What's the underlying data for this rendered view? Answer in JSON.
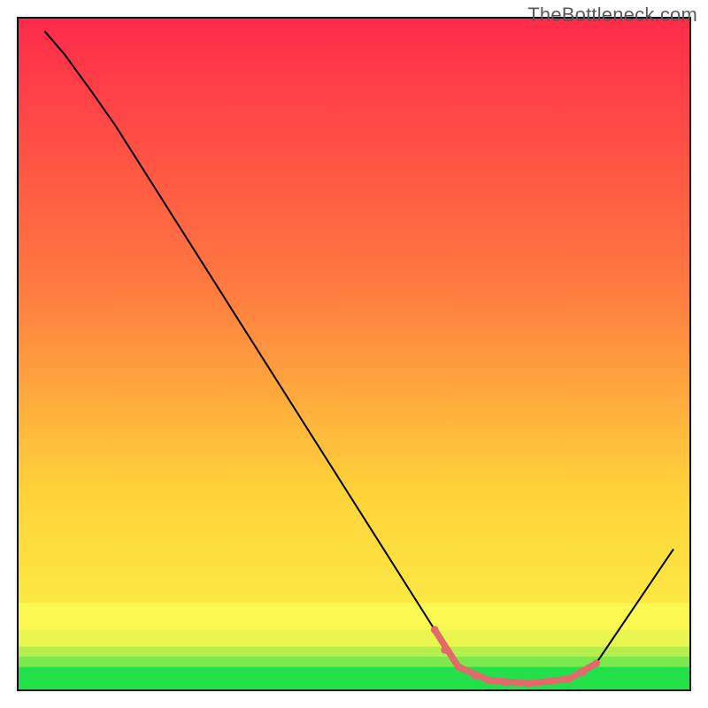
{
  "watermark": "TheBottleneck.com",
  "chart_data": {
    "type": "line",
    "title": "",
    "xlabel": "",
    "ylabel": "",
    "xlim": [
      0,
      100
    ],
    "ylim": [
      0,
      100
    ],
    "grid": false,
    "legend": false,
    "overlay_bands": [
      {
        "color": "#22e04a",
        "y_from": 0,
        "y_to": 3.5
      },
      {
        "color": "#7de84c",
        "y_from": 3.5,
        "y_to": 5.0
      },
      {
        "color": "#b6ee4d",
        "y_from": 5.0,
        "y_to": 6.5
      },
      {
        "color": "#e9f64f",
        "y_from": 6.5,
        "y_to": 9.0
      },
      {
        "color": "#fbf951",
        "y_from": 9.0,
        "y_to": 13.0
      }
    ],
    "background_gradient": {
      "top": "#ff2a4a",
      "mid1": "#ff7a40",
      "mid2": "#ffd23a",
      "bottom": "#f9f94a"
    },
    "series": [
      {
        "name": "bottleneck-curve",
        "stroke": "#000000",
        "stroke_width": 2.0,
        "data": [
          {
            "x": 4.0,
            "y": 98.0
          },
          {
            "x": 7.0,
            "y": 94.5
          },
          {
            "x": 11.0,
            "y": 89.0
          },
          {
            "x": 14.5,
            "y": 84.0
          },
          {
            "x": 62.0,
            "y": 9.0
          },
          {
            "x": 65.5,
            "y": 3.5
          },
          {
            "x": 70.0,
            "y": 1.5
          },
          {
            "x": 76.0,
            "y": 1.0
          },
          {
            "x": 82.0,
            "y": 1.7
          },
          {
            "x": 86.0,
            "y": 4.0
          },
          {
            "x": 97.5,
            "y": 21.0
          }
        ]
      },
      {
        "name": "valley-highlight",
        "stroke": "#e26a6a",
        "stroke_width": 7.5,
        "linecap": "round",
        "data": [
          {
            "x": 62.0,
            "y": 9.0
          },
          {
            "x": 65.5,
            "y": 3.5
          },
          {
            "x": 70.0,
            "y": 1.5
          },
          {
            "x": 76.0,
            "y": 1.0
          },
          {
            "x": 82.0,
            "y": 1.7
          },
          {
            "x": 86.0,
            "y": 4.0
          }
        ],
        "dots": [
          {
            "x": 62.0,
            "y": 9.0
          },
          {
            "x": 63.5,
            "y": 6.0
          },
          {
            "x": 65.5,
            "y": 3.5
          },
          {
            "x": 68.0,
            "y": 2.2
          },
          {
            "x": 70.0,
            "y": 1.5
          },
          {
            "x": 72.5,
            "y": 1.2
          },
          {
            "x": 76.0,
            "y": 1.0
          },
          {
            "x": 79.0,
            "y": 1.3
          },
          {
            "x": 82.0,
            "y": 1.7
          },
          {
            "x": 84.0,
            "y": 2.7
          },
          {
            "x": 86.0,
            "y": 4.0
          }
        ]
      }
    ],
    "frame": {
      "x": 2.5,
      "y": 2.5,
      "w": 95.0,
      "h": 95.0,
      "stroke": "#000000",
      "stroke_width": 2.0
    }
  }
}
